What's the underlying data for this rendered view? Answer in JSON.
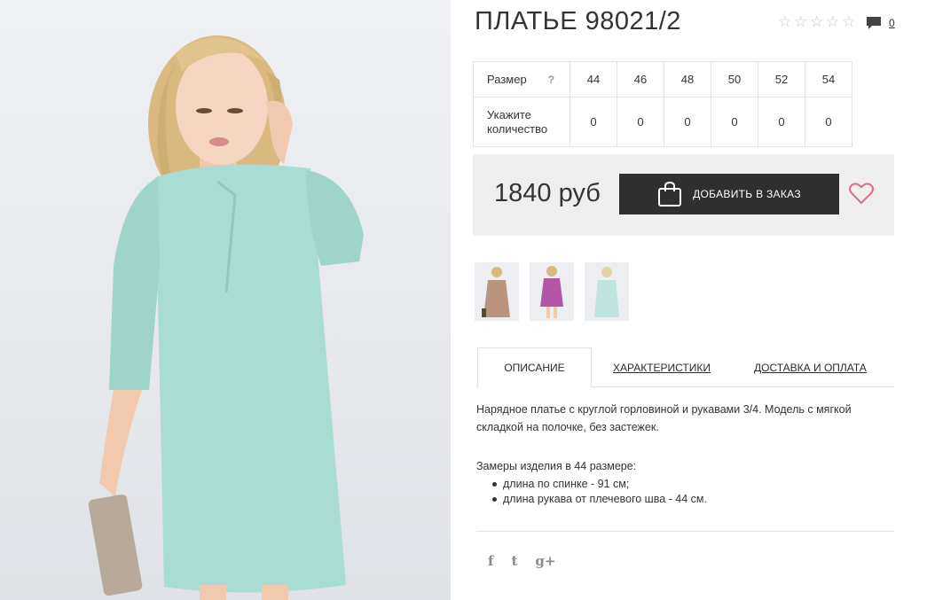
{
  "product": {
    "title": "ПЛАТЬЕ 98021/2",
    "rating_stars": 5,
    "rating_value": 0,
    "comments_count": "0"
  },
  "sizes": {
    "label_size": "Размер",
    "help": "?",
    "label_qty_line1": "Укажите",
    "label_qty_line2": "количество",
    "values": [
      "44",
      "46",
      "48",
      "50",
      "52",
      "54"
    ],
    "quantities": [
      "0",
      "0",
      "0",
      "0",
      "0",
      "0"
    ]
  },
  "buy": {
    "price": "1840 руб",
    "add_button": "ДОБАВИТЬ В ЗАКАЗ"
  },
  "thumbnails": [
    {
      "name": "thumb-beige-dress",
      "color": "#b8957c"
    },
    {
      "name": "thumb-pink-dress",
      "color": "#b455a6"
    },
    {
      "name": "thumb-mint-dress",
      "color": "#bfe4df"
    }
  ],
  "tabs": {
    "description": "ОПИСАНИЕ",
    "characteristics": "ХАРАКТЕРИСТИКИ",
    "delivery": "ДОСТАВКА И ОПЛАТА"
  },
  "description": {
    "text": "Нарядное платье с круглой горловиной и рукавами 3/4. Модель с мягкой складкой на полочке, без застежек.",
    "measures_title": "Замеры изделия в 44 размере:",
    "measures": [
      "длина по спинке - 91 см;",
      "длина рукава от плечевого шва - 44 см."
    ]
  },
  "social": {
    "facebook": "f",
    "twitter": "t",
    "googleplus": "g+"
  },
  "colors": {
    "dress": "#a9ddd4",
    "button": "#2f2f2f",
    "heart": "#e06a86"
  }
}
